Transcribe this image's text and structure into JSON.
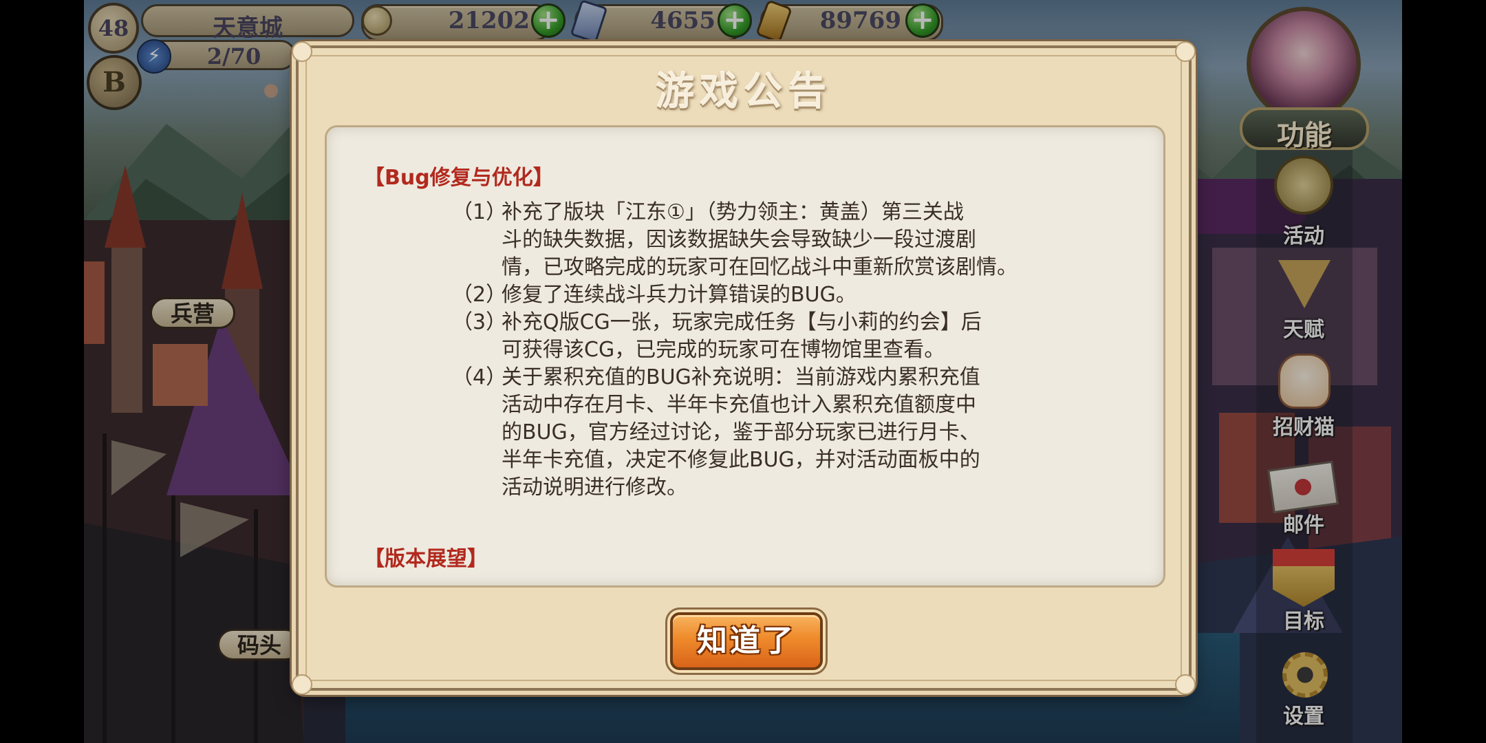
{
  "player": {
    "level": "48",
    "city_name": "天意城",
    "energy": "2/70",
    "vip_badge": "B"
  },
  "resources": [
    {
      "name": "silver-coin",
      "value": "21202",
      "icon": "coin-icon",
      "color": "#b8a675"
    },
    {
      "name": "ticket",
      "value": "4655",
      "icon": "ticket-icon",
      "color": "#6f86b5"
    },
    {
      "name": "gold-ingot",
      "value": "89769",
      "icon": "gold-icon",
      "color": "#c79a3c"
    }
  ],
  "map_labels": {
    "barracks": "兵营",
    "dock": "码头"
  },
  "side_menu": {
    "function": "功能",
    "activity": "活动",
    "talent": "天赋",
    "lucky_cat": "招财猫",
    "mail": "邮件",
    "goal": "目标",
    "settings": "设置"
  },
  "dialog": {
    "title": "游戏公告",
    "sections": [
      {
        "heading": "【Bug修复与优化】",
        "items": [
          {
            "num": "（1）",
            "lines": [
              "补充了版块「江东①」（势力领主：黄盖）第三关战",
              "斗的缺失数据，因该数据缺失会导致缺少一段过渡剧",
              "情，已攻略完成的玩家可在回忆战斗中重新欣赏该剧情。"
            ]
          },
          {
            "num": "（2）",
            "lines": [
              "修复了连续战斗兵力计算错误的BUG。"
            ]
          },
          {
            "num": "（3）",
            "lines": [
              "补充Q版CG一张，玩家完成任务【与小莉的约会】后",
              "可获得该CG，已完成的玩家可在博物馆里查看。"
            ]
          },
          {
            "num": "（4）",
            "lines": [
              "关于累积充值的BUG补充说明：当前游戏内累积充值",
              "活动中存在月卡、半年卡充值也计入累积充值额度中",
              "的BUG，官方经过讨论，鉴于部分玩家已进行月卡、",
              "半年卡充值，决定不修复此BUG，并对活动面板中的",
              "活动说明进行修改。"
            ]
          }
        ]
      },
      {
        "heading": "【版本展望】",
        "items": []
      }
    ],
    "confirm_button": "知道了"
  },
  "colors": {
    "dialog_bg": "#ecdcba",
    "panel_bg": "#eeeae0",
    "heading_red": "#b2291e",
    "button_orange": "#ef8a2b",
    "plus_green": "#37a02a"
  }
}
